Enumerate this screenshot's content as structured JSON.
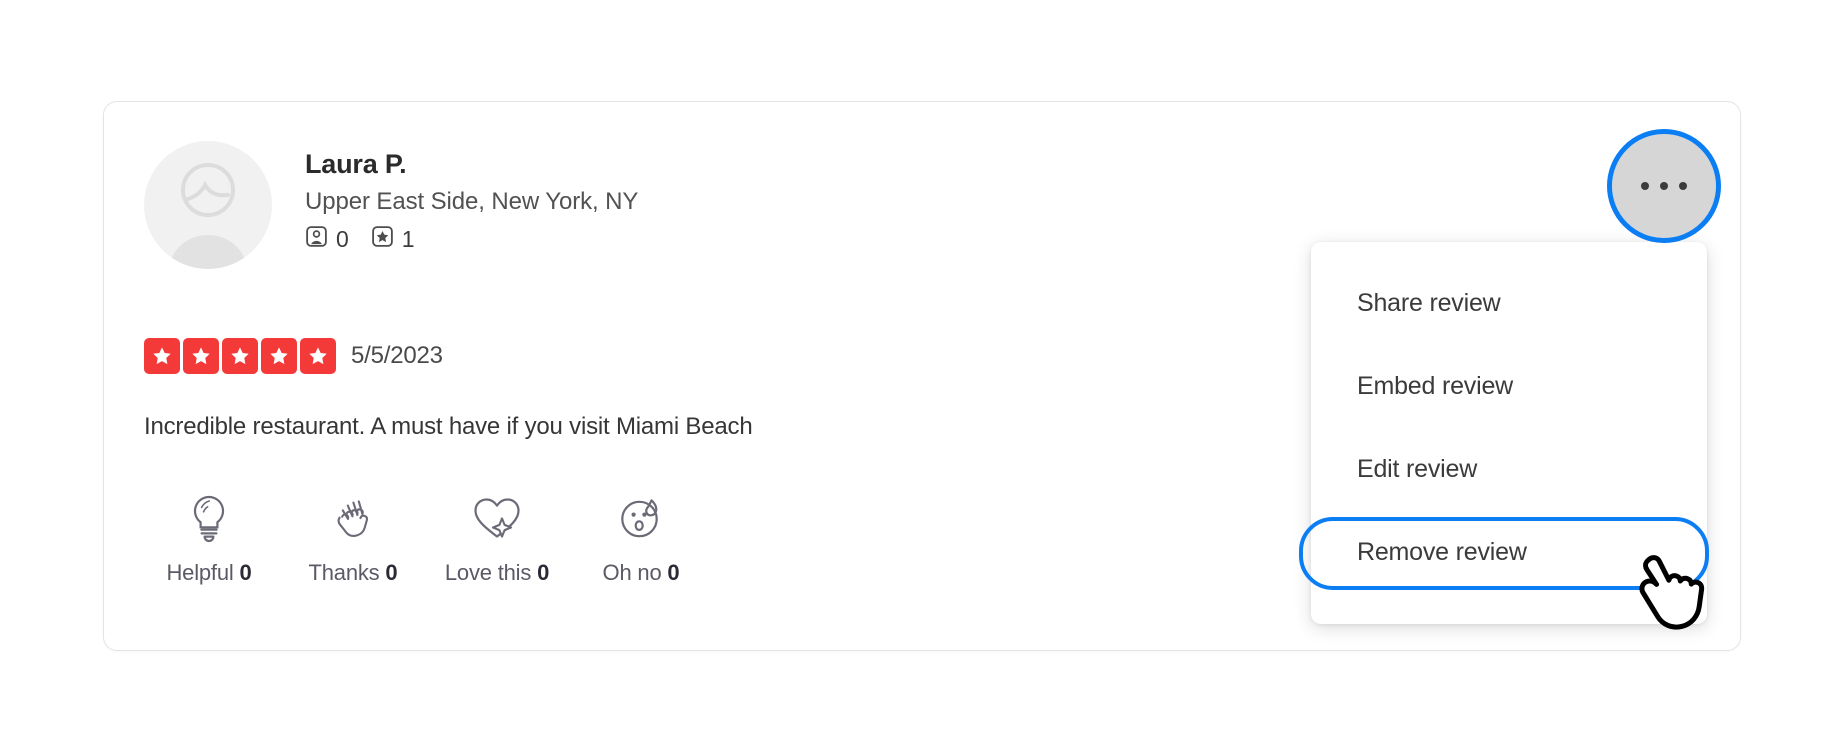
{
  "review": {
    "reviewer": {
      "name": "Laura P.",
      "location": "Upper East Side, New York, NY",
      "avatar_icon": "user-avatar-placeholder-icon",
      "stats": [
        {
          "icon": "friends-icon",
          "value": "0"
        },
        {
          "icon": "reviews-star-icon",
          "value": "1"
        }
      ]
    },
    "rating": {
      "value": 5,
      "max": 5,
      "star_color": "#f43939",
      "star_icon": "star-icon"
    },
    "date": "5/5/2023",
    "text": "Incredible restaurant. A must have if you visit Miami Beach",
    "reactions": [
      {
        "icon": "lightbulb-icon",
        "label": "Helpful",
        "count": "0"
      },
      {
        "icon": "waving-hand-icon",
        "label": "Thanks",
        "count": "0"
      },
      {
        "icon": "heart-sparkle-icon",
        "label": "Love this",
        "count": "0"
      },
      {
        "icon": "surprised-face-icon",
        "label": "Oh no",
        "count": "0"
      }
    ]
  },
  "more_menu": {
    "trigger": {
      "icon": "ellipsis-icon",
      "aria_label": "More options",
      "focus_ring_color": "#0b7ef4",
      "background_color": "#d6d6d6"
    },
    "items": [
      {
        "label": "Share review",
        "highlighted": false
      },
      {
        "label": "Embed review",
        "highlighted": false
      },
      {
        "label": "Edit review",
        "highlighted": false
      },
      {
        "label": "Remove review",
        "highlighted": true
      }
    ],
    "highlight_color": "#0b7ef4"
  },
  "cursor": {
    "icon": "pointing-hand-cursor-icon"
  }
}
